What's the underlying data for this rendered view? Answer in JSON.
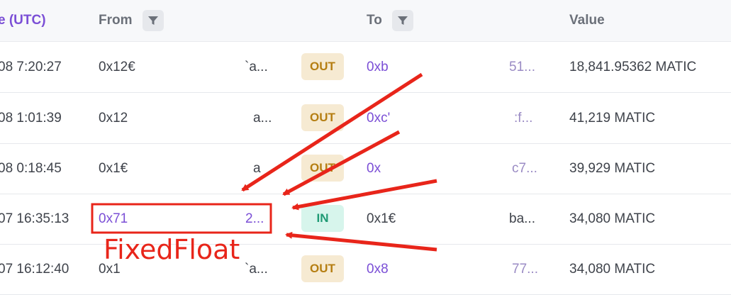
{
  "header": {
    "time_label": "e (UTC)",
    "from_label": "From",
    "to_label": "To",
    "value_label": "Value"
  },
  "rows": [
    {
      "time": "08 7:20:27",
      "from_start": "0x12€",
      "from_end": "`a...",
      "direction": "OUT",
      "to_start": "0xb",
      "to_end": "51...",
      "value": "18,841.95362 MATIC"
    },
    {
      "time": "08 1:01:39",
      "from_start": "0x12",
      "from_end": "a...",
      "direction": "OUT",
      "to_start": "0xc'",
      "to_end": ":f...",
      "value": "41,219 MATIC"
    },
    {
      "time": "08 0:18:45",
      "from_start": "0x1€",
      "from_end": "a",
      "direction": "OUT",
      "to_start": "0x",
      "to_end": "c7...",
      "value": "39,929 MATIC"
    },
    {
      "time": "07 16:35:13",
      "from_start": "0x71",
      "from_end": "2...",
      "direction": "IN",
      "to_start": "0x1€",
      "to_end": "ba...",
      "value": "34,080 MATIC"
    },
    {
      "time": "07 16:12:40",
      "from_start": "0x1",
      "from_end": "`a...",
      "direction": "OUT",
      "to_start": "0x8",
      "to_end": "77...",
      "value": "34,080 MATIC"
    }
  ],
  "annotation": {
    "label": "FixedFloat",
    "color": "#e8251a"
  },
  "colors": {
    "accent": "#7b4fd6",
    "out_badge": "#f6ead2",
    "in_badge": "#d7f5ec",
    "annotation": "#e8251a"
  }
}
